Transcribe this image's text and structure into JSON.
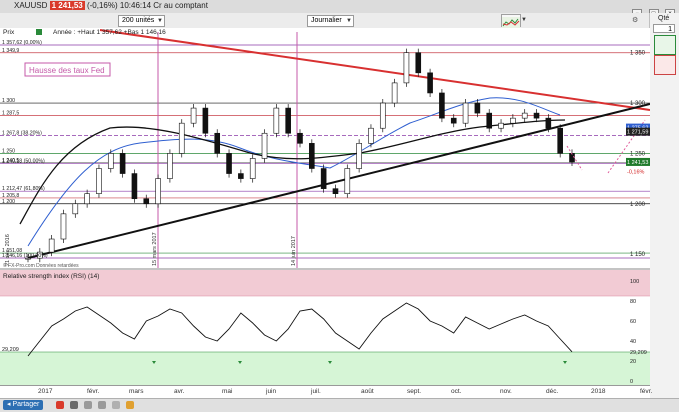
{
  "window": {
    "title": "XAUUSD",
    "price": "1 241,53",
    "change": "(-0,16%)",
    "time": "10:46:14 Cr au comptant",
    "controls": [
      "−",
      "□",
      "×"
    ]
  },
  "toolbar": {
    "units": "200 unités",
    "period": "Journalier"
  },
  "right_panel": {
    "qte_label": "Qté",
    "qte_value": "1"
  },
  "chart": {
    "prix_label": "Prix",
    "legend": "Année : +Haut 1 357,62 +Bas 1 146,16",
    "annotation_box": "Hausse des taux Fed",
    "vline_labels": [
      "15 mars 2017",
      "14 juin 2017"
    ],
    "start_date": "21 déc. 2016",
    "source": "© FX-Pro.com Données retardées",
    "left_levels": [
      {
        "label": "1 357,62 (0,00%)",
        "y": 1357.62
      },
      {
        "label": "1 349,9",
        "y": 1349.9
      },
      {
        "label": "1 300",
        "y": 1300
      },
      {
        "label": "1 287,5",
        "y": 1287.5
      },
      {
        "label": "1 267,8 (38,20%)",
        "y": 1267.8
      },
      {
        "label": "1 250",
        "y": 1250
      },
      {
        "label": "1 240,5",
        "y": 1240.5
      },
      {
        "label": "1 240,18 (50,00%)",
        "y": 1240.18
      },
      {
        "label": "1 212,47 (61,80%)",
        "y": 1212.47
      },
      {
        "label": "1 205,8",
        "y": 1205.8
      },
      {
        "label": "1 200",
        "y": 1200
      },
      {
        "label": "1 151,08",
        "y": 1151.08
      },
      {
        "label": "1 146,16 (100,00%)",
        "y": 1146.16
      }
    ],
    "right_ticks": [
      "1 350",
      "1 300",
      "1 250",
      "1 200",
      "1 150"
    ],
    "price_tags": [
      {
        "label": "1 275,62",
        "y": 1275.62,
        "color": "#2f5fd0"
      },
      {
        "label": "1 271,59",
        "y": 1271.59,
        "color": "#222222"
      },
      {
        "label": "1 241,53",
        "y": 1241.53,
        "color": "#1f7a2b"
      },
      {
        "label": "-0,16%",
        "y": 1236,
        "color": "#d21f1f"
      }
    ]
  },
  "rsi": {
    "title": "Relative strength index (RSI) (14)",
    "right_ticks": [
      "100",
      "80",
      "60",
      "40",
      "29,209",
      "20",
      "0"
    ],
    "left_value": "29,209",
    "current": 29.209
  },
  "xaxis": {
    "labels": [
      "2017",
      "févr.",
      "mars",
      "avr.",
      "mai",
      "juin",
      "juil.",
      "août",
      "sept.",
      "oct.",
      "nov.",
      "déc.",
      "2018",
      "févr."
    ]
  },
  "bottom": {
    "share": "Partager"
  },
  "colors": {
    "title_red": "#d93a2b",
    "trend_red": "#d83030",
    "ma_blue": "#2f5fd0",
    "ma_black": "#111111",
    "fib_purple": "#8a3aa8",
    "support_green": "#2a8a3a",
    "rsi_overbought": "#f2cbd4",
    "rsi_oversold": "#d6f5d6"
  },
  "chart_data": {
    "type": "line",
    "title": "XAUUSD",
    "xlabel": "",
    "ylabel": "Prix",
    "ylim": [
      1136,
      1372
    ],
    "series": [
      {
        "name": "XAUUSD",
        "values": [
          1146,
          1152,
          1165,
          1190,
          1200,
          1210,
          1235,
          1250,
          1230,
          1205,
          1200,
          1225,
          1250,
          1280,
          1295,
          1270,
          1250,
          1230,
          1225,
          1245,
          1270,
          1295,
          1270,
          1260,
          1235,
          1215,
          1210,
          1235,
          1260,
          1275,
          1300,
          1320,
          1350,
          1330,
          1310,
          1285,
          1280,
          1300,
          1290,
          1275,
          1280,
          1285,
          1290,
          1285,
          1275,
          1250,
          1241.53
        ]
      }
    ]
  }
}
